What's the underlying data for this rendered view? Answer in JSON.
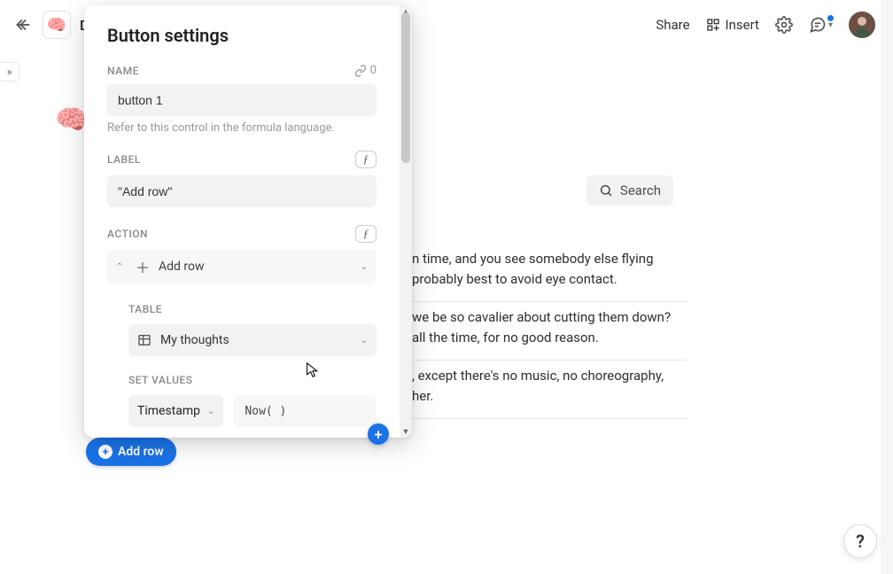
{
  "topbar": {
    "doc_title_letter": "D",
    "share": "Share",
    "insert": "Insert"
  },
  "panel": {
    "title": "Button settings",
    "name_label": "NAME",
    "name_value": "button 1",
    "name_link_count": "0",
    "name_help": "Refer to this control in the formula language.",
    "label_label": "LABEL",
    "label_value": "\"Add row\"",
    "action_label": "ACTION",
    "action_name": "Add row",
    "table_label": "TABLE",
    "table_name": "My thoughts",
    "set_values_label": "SET VALUES",
    "set_values_column": "Timestamp",
    "set_values_formula": "Now( )"
  },
  "doc": {
    "search_label": "Search",
    "snippet1": "n time, and you see somebody else flying probably best to avoid eye contact.",
    "snippet2": "we be so cavalier about cutting them down? all the time, for no good reason.",
    "snippet3": ", except there's no music, no choreography, her."
  },
  "button_pill": {
    "label": "Add row"
  },
  "help": {
    "q": "?"
  }
}
